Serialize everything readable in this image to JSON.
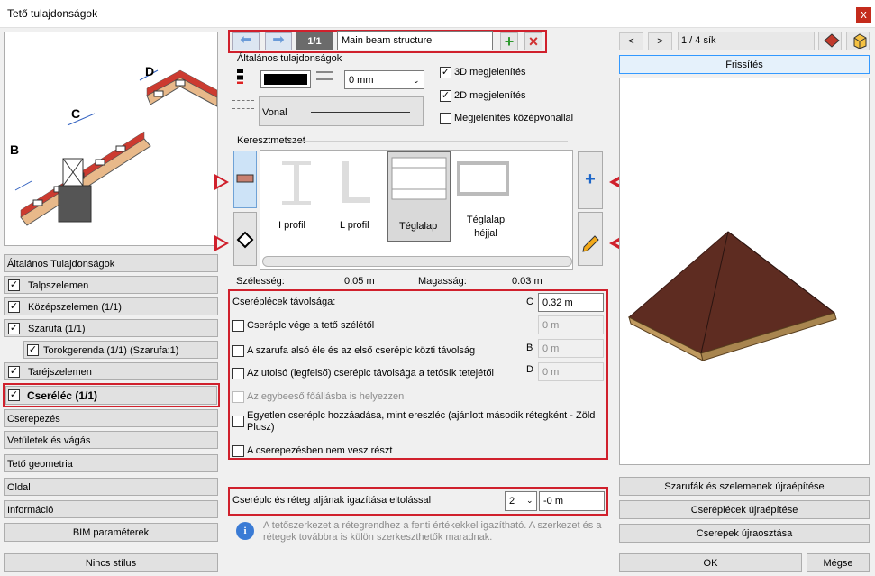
{
  "window": {
    "title": "Tető tulajdonságok",
    "close": "x"
  },
  "left_nav": {
    "items": [
      {
        "label": "Általános Tulajdonságok",
        "check": false
      },
      {
        "label": "Talpszelemen",
        "check": true
      },
      {
        "label": "Középszelemen (1/1)",
        "check": true
      },
      {
        "label": "Szarufa (1/1)",
        "check": true
      },
      {
        "label": "Torokgerenda (1/1) (Szarufa:1)",
        "check": true
      },
      {
        "label": "Taréjszelemen",
        "check": true
      },
      {
        "label": "Cseréléc (1/1)",
        "check": true
      },
      {
        "label": "Cserepezés",
        "check": false
      },
      {
        "label": "Vetületek és vágás",
        "check": false
      },
      {
        "label": "Tető geometria",
        "check": false
      },
      {
        "label": "Oldal",
        "check": false
      },
      {
        "label": "Információ",
        "check": false
      }
    ],
    "bim_button": "BIM paraméterek",
    "style_button": "Nincs stílus",
    "diagram_labels": {
      "b": "B",
      "c": "C",
      "d": "D"
    }
  },
  "toolbar": {
    "counter": "1/1",
    "name_value": "Main beam structure",
    "add": "+",
    "delete": "×"
  },
  "general": {
    "title": "Általános tulajdonságok",
    "offset_value": "0 mm",
    "line_label": "Vonal",
    "show_3d": "3D megjelenítés",
    "show_2d": "2D megjelenítés",
    "show_centerline": "Megjelenítés középvonallal"
  },
  "cross_section": {
    "title": "Keresztmetszet",
    "profiles": [
      "I profil",
      "L profil",
      "Téglalap",
      "Téglalap\nhéjjal"
    ],
    "width_label": "Szélesség:",
    "width_value": "0.05 m",
    "height_label": "Magasság:",
    "height_value": "0.03 m"
  },
  "battens": {
    "distance_label": "Cseréplécek távolsága:",
    "c_letter": "C",
    "c_value": "0.32 m",
    "end_label": "Cseréplc vége a tető szélétől",
    "end_value": "0 m",
    "rafter_label": "A szarufa alsó éle és az első cseréplc közti távolság",
    "b_letter": "B",
    "b_value": "0 m",
    "last_label": "Az utolsó (legfelső) cseréplc távolsága a tetősík tetejétől",
    "d_letter": "D",
    "d_value": "0 m",
    "single_layer_label": "Az egybeeső főállásba is helyezzen",
    "single_eaves_label": "Egyetlen cseréplc hozzáadása, mint ereszléc (ajánlott második rétegként - Zöld Plusz)",
    "no_tiling_label": "A cserepezésben nem vesz részt"
  },
  "alignment": {
    "label": "Cseréplc és réteg aljának igazítása eltolással",
    "select": "2",
    "value": "-0 m"
  },
  "info_text": "A tetőszerkezet a rétegrendhez a fenti értékekkel igazítható. A szerkezet és a rétegek továbbra is külön szerkeszthetők maradnak.",
  "preview": {
    "prev": "<",
    "next": ">",
    "page": "1 / 4 sík",
    "refresh": "Frissítés",
    "rebuild_rafters": "Szarufák és szelemenek újraépítése",
    "rebuild_battens": "Cseréplécek újraépítése",
    "redistribute_tiles": "Cserepek újraosztása"
  },
  "footer": {
    "ok": "OK",
    "cancel": "Mégse"
  },
  "colors": {
    "accent": "#d0202c",
    "select_blue": "#3399ff",
    "roof": "#5e2c21"
  }
}
